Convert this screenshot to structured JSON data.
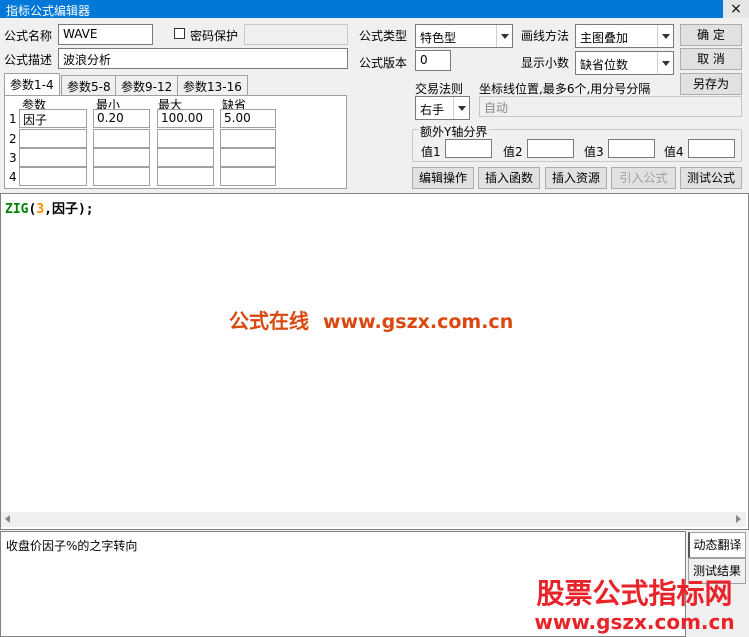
{
  "window": {
    "title": "指标公式编辑器",
    "close_glyph": "×"
  },
  "form": {
    "name_label": "公式名称",
    "name_value": "WAVE",
    "password_label": "密码保护",
    "desc_label": "公式描述",
    "desc_value": "波浪分析",
    "type_label": "公式类型",
    "type_value": "特色型",
    "draw_label": "画线方法",
    "draw_value": "主图叠加",
    "version_label": "公式版本",
    "version_value": "0",
    "decimals_label": "显示小数",
    "decimals_value": "缺省位数",
    "trade_label": "交易法则",
    "trade_value": "右手",
    "coord_label": "坐标线位置,最多6个,用分号分隔",
    "coord_value": "自动",
    "yaxis_label": "额外Y轴分界",
    "y1_label": "值1",
    "y2_label": "值2",
    "y3_label": "值3",
    "y4_label": "值4"
  },
  "tabs": [
    "参数1-4",
    "参数5-8",
    "参数9-12",
    "参数13-16"
  ],
  "params": {
    "headers": [
      "参数",
      "最小",
      "最大",
      "缺省"
    ],
    "rows": [
      {
        "index": "1",
        "name": "因子",
        "min": "0.20",
        "max": "100.00",
        "default": "5.00"
      },
      {
        "index": "2",
        "name": "",
        "min": "",
        "max": "",
        "default": ""
      },
      {
        "index": "3",
        "name": "",
        "min": "",
        "max": "",
        "default": ""
      },
      {
        "index": "4",
        "name": "",
        "min": "",
        "max": "",
        "default": ""
      }
    ]
  },
  "buttons": {
    "ok": "确  定",
    "cancel": "取  消",
    "save_as": "另存为",
    "edit_ops": "编辑操作",
    "insert_func": "插入函数",
    "insert_res": "插入资源",
    "import_formula": "引入公式",
    "test_formula": "测试公式"
  },
  "editor": {
    "func": "ZIG",
    "open": "(",
    "num": "3",
    "rest": ",因子);"
  },
  "description": {
    "text": "收盘价因子%的之字转向"
  },
  "side_tabs": {
    "translate": "动态翻译",
    "test_result": "测试结果"
  },
  "watermark": {
    "cn": "公式在线",
    "url": "www.gszx.com.cn"
  },
  "corner_logo": {
    "line1": "股票公式指标网",
    "line2": "www.gszx.com.cn"
  },
  "colors": {
    "titlebar": "#0078d7",
    "code_func": "#008000",
    "code_num": "#ff8c00",
    "watermark": "#d9480f",
    "logo": "#e8232a"
  }
}
